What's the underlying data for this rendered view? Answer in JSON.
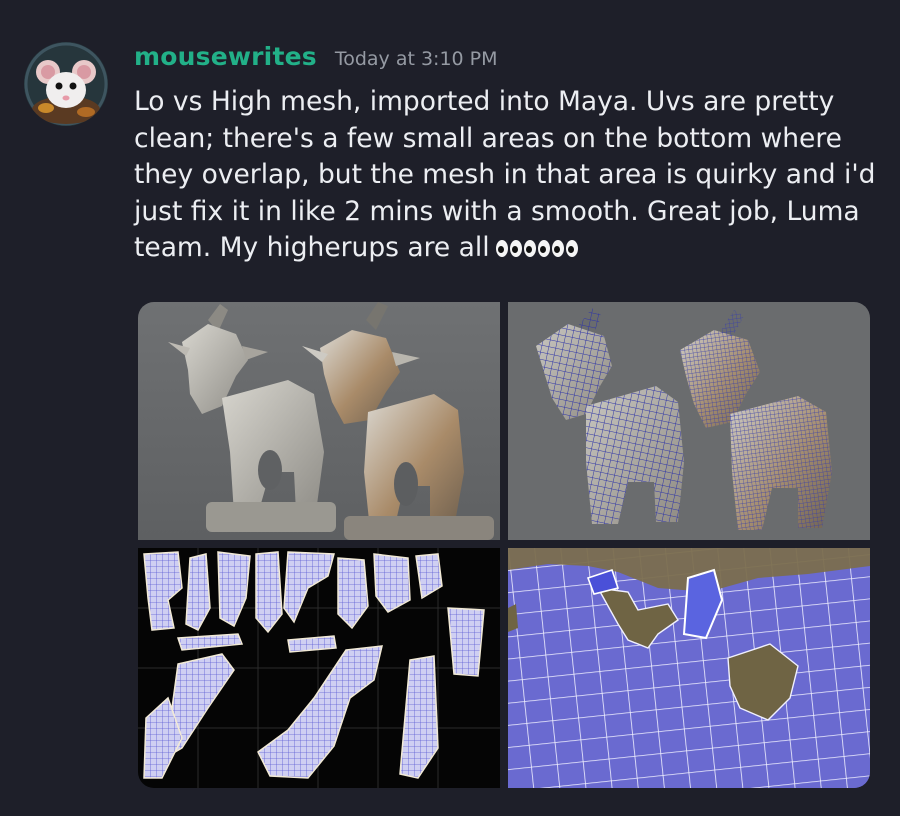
{
  "message": {
    "author": "mousewrites",
    "timestamp": "Today at 3:10 PM",
    "text": "Lo vs High mesh, imported into Maya. Uvs are pretty clean; there's a few small areas on the bottom where they overlap, but the mesh in that area is quirky and i'd just fix it in like 2 mins with a smooth. Great job, Luma team. My higherups are all",
    "reaction_emoji_name": "eyes-icon",
    "reaction_emoji_count": 6
  },
  "attachments": [
    {
      "name": "goat-render-comparison-image"
    },
    {
      "name": "goat-wireframe-comparison-image"
    },
    {
      "name": "uv-layout-image"
    },
    {
      "name": "uv-overlap-closeup-image"
    }
  ],
  "colors": {
    "background": "#1e1f29",
    "username": "#22b088",
    "timestamp": "#959aa3",
    "text": "#eceef2",
    "viewport_gray": "#686a6c",
    "wire_blue": "#3a3fa8",
    "uv_fill": "#6b6bd0"
  }
}
